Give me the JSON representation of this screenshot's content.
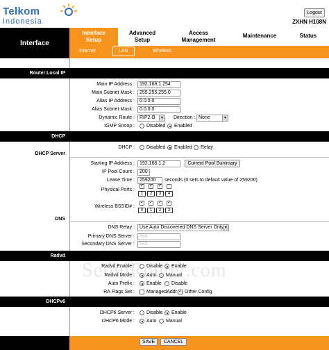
{
  "brand": {
    "logo_line1": "Telkom",
    "logo_line2": "Indonesia",
    "model": "ZXHN H108N",
    "logout": "Logout",
    "accent": "#f7941d",
    "brand_blue": "#2f6bb5"
  },
  "nav": {
    "section": "Interface",
    "tabs": [
      {
        "line1": "Interface",
        "line2": "Setup",
        "active": true
      },
      {
        "line1": "Advanced",
        "line2": "Setup"
      },
      {
        "line1": "Access",
        "line2": "Management"
      },
      {
        "line1": "Maintenance",
        "line2": ""
      },
      {
        "line1": "Status",
        "line2": ""
      }
    ],
    "subtabs": [
      "Internet",
      "LAN",
      "Wireless"
    ],
    "active_subtab": "LAN"
  },
  "router_local_ip": {
    "title": "Router Local IP",
    "main_ip_label": "Main IP Address :",
    "main_ip": "192.168.1.254",
    "main_mask_label": "Main Subnet Mask :",
    "main_mask": "255.255.255.0",
    "alias_ip_label": "Alias IP Address :",
    "alias_ip": "0.0.0.0",
    "alias_mask_label": "Alias Subnet Mask :",
    "alias_mask": "0.0.0.0",
    "dynamic_route_label": "Dynamic Route :",
    "dynamic_route": "RIP2-B",
    "direction_label": "Direction :",
    "direction": "None",
    "igmp_label": "IGMP Snoop :",
    "igmp_disabled": "Disabled",
    "igmp_enabled": "Enabled",
    "igmp_value": "Enabled"
  },
  "dhcp": {
    "title": "DHCP",
    "dhcp_label": "DHCP :",
    "opt_disabled": "Disabled",
    "opt_enabled": "Enabled",
    "opt_relay": "Relay",
    "value": "Enabled"
  },
  "dhcp_server": {
    "title": "DHCP Server",
    "start_ip_label": "Starting IP Address :",
    "start_ip": "192.168.1.2",
    "pool_summary_button": "Current Pool Summary",
    "pool_count_label": "IP Pool Count :",
    "pool_count": "200",
    "lease_label": "Lease Time :",
    "lease_time": "259200",
    "lease_hint": "seconds   (0 sets to default value of 259200)",
    "physical_ports_label": "Physical Ports :",
    "physical_ports": [
      "1",
      "2",
      "3",
      "4"
    ],
    "physical_ports_checked": [
      true,
      true,
      true,
      false
    ],
    "wireless_bssid_label": "Wireless BSSID# :",
    "wireless_bssid": [
      "0",
      "1",
      "2",
      "3"
    ],
    "wireless_bssid_checked": [
      true,
      true,
      true,
      true
    ]
  },
  "dns": {
    "title": "DNS",
    "relay_label": "DNS Relay :",
    "relay": "Use Auto Discovered DNS Server Only",
    "primary_label": "Primary DNS Server :",
    "primary": "N/A",
    "secondary_label": "Secondary DNS Server :",
    "secondary": "N/A"
  },
  "radvd": {
    "title": "Radvd",
    "enable_label": "Radvd Enable :",
    "enable_opt_disable": "Disable",
    "enable_opt_enable": "Enable",
    "enable_value": "Enable",
    "mode_label": "Radvd Mode :",
    "mode_opt_auto": "Auto",
    "mode_opt_manual": "Manual",
    "mode_value": "Auto",
    "prefix_label": "Auto Prefix :",
    "prefix_opt_enable": "Enable",
    "prefix_opt_disable": "Disable",
    "prefix_value": "Enable",
    "flags_label": "RA Flags Set :",
    "flag_managed": "ManagedAddr",
    "flag_managed_checked": false,
    "flag_other": "Other Config",
    "flag_other_checked": true
  },
  "dhcpv6": {
    "title": "DHCPv6",
    "server_label": "DHCP6 Server :",
    "server_opt_disable": "Disable",
    "server_opt_enable": "Enable",
    "server_value": "Enable",
    "mode_label": "DHCP6 Mode :",
    "mode_opt_auto": "Auto",
    "mode_opt_manual": "Manual",
    "mode_value": "Auto"
  },
  "footer": {
    "save": "SAVE",
    "cancel": "CANCEL"
  },
  "watermark": "SetupRouter.com"
}
